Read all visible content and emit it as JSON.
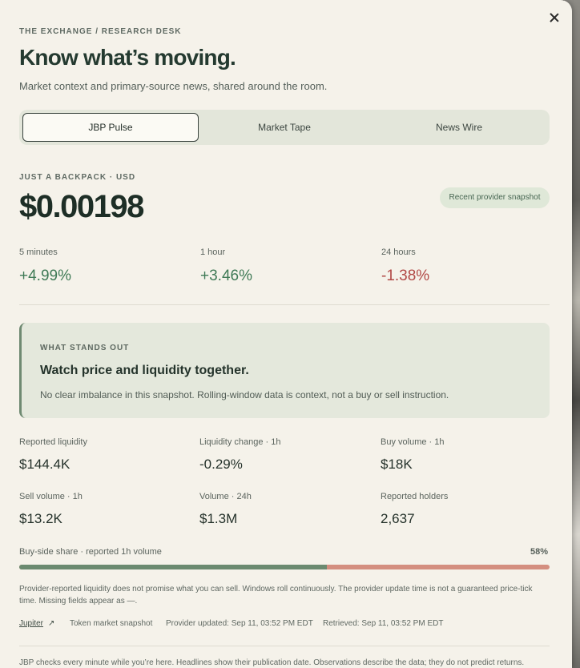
{
  "header": {
    "kicker": "THE EXCHANGE / RESEARCH DESK",
    "title": "Know what’s moving.",
    "subtitle": "Market context and primary-source news, shared around the room."
  },
  "tabs": [
    {
      "label": "JBP Pulse",
      "active": true
    },
    {
      "label": "Market Tape",
      "active": false
    },
    {
      "label": "News Wire",
      "active": false
    }
  ],
  "asset": {
    "name_line": "JUST A BACKPACK · USD",
    "price": "$0.00198",
    "snapshot_badge": "Recent provider snapshot"
  },
  "changes": [
    {
      "label": "5 minutes",
      "value": "+4.99%"
    },
    {
      "label": "1 hour",
      "value": "+3.46%"
    },
    {
      "label": "24 hours",
      "value": "-1.38%"
    }
  ],
  "callout": {
    "kicker": "WHAT STANDS OUT",
    "title": "Watch price and liquidity together.",
    "body": "No clear imbalance in this snapshot. Rolling-window data is context, not a buy or sell instruction."
  },
  "metrics": [
    {
      "label": "Reported liquidity",
      "value": "$144.4K"
    },
    {
      "label": "Liquidity change · 1h",
      "value": "-0.29%"
    },
    {
      "label": "Buy volume · 1h",
      "value": "$18K"
    },
    {
      "label": "Sell volume · 1h",
      "value": "$13.2K"
    },
    {
      "label": "Volume · 24h",
      "value": "$1.3M"
    },
    {
      "label": "Reported holders",
      "value": "2,637"
    }
  ],
  "buy_share": {
    "label": "Buy-side share · reported 1h volume",
    "percent_text": "58%",
    "fraction": 0.58,
    "buy_color": "#6b8a70",
    "sell_color": "#d48f80"
  },
  "disclaimer": "Provider-reported liquidity does not promise what you can sell. Windows roll continuously. The provider update time is not a guaranteed price-tick time. Missing fields appear as —.",
  "source": {
    "link": "Jupiter",
    "link_icon": "external-link-icon",
    "type": "Token market snapshot",
    "updated": "Provider updated: Sep 11, 03:52 PM EDT",
    "retrieved": "Retrieved: Sep 11, 03:52 PM EDT"
  },
  "footer": "JBP checks every minute while you’re here. Headlines show their publication date. Observations describe the data; they do not predict returns.",
  "colors": {
    "positive": "#3f7a56",
    "negative": "#b24a47",
    "panel_bg": "#f5f2ea"
  }
}
